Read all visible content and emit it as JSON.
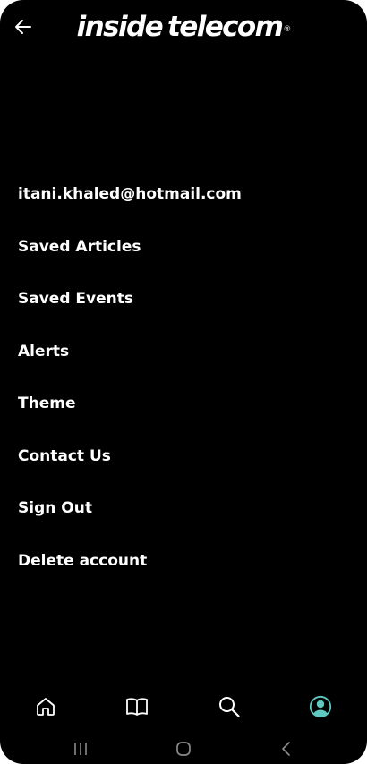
{
  "header": {
    "back_icon": "arrow-left-icon",
    "logo_word1": "inside",
    "logo_word2": "telecom",
    "logo_mark": "®"
  },
  "menu": {
    "items": [
      {
        "label": "itani.khaled@hotmail.com"
      },
      {
        "label": "Saved Articles"
      },
      {
        "label": "Saved Events"
      },
      {
        "label": "Alerts"
      },
      {
        "label": "Theme"
      },
      {
        "label": "Contact Us"
      },
      {
        "label": "Sign Out"
      },
      {
        "label": "Delete account"
      }
    ]
  },
  "bottom_nav": {
    "items": [
      {
        "icon": "home-icon"
      },
      {
        "icon": "book-icon"
      },
      {
        "icon": "search-icon"
      },
      {
        "icon": "profile-icon",
        "active": true,
        "active_color": "#5fc8c0"
      }
    ]
  },
  "system_nav": {
    "items": [
      {
        "icon": "recent-apps-icon"
      },
      {
        "icon": "home-circle-icon"
      },
      {
        "icon": "back-chevron-icon"
      }
    ]
  },
  "colors": {
    "background": "#000000",
    "text": "#ffffff",
    "accent": "#5fc8c0",
    "system_icons": "#8a8a8a"
  }
}
